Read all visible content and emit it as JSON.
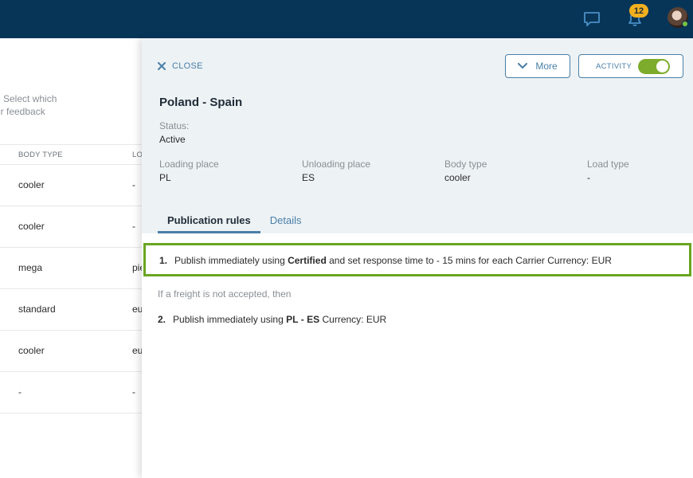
{
  "topbar": {
    "notification_count": "12",
    "colors": {
      "background": "#073558",
      "badge": "#f2b01e"
    },
    "icons": [
      "chat-icon",
      "bell-icon",
      "user-avatar"
    ]
  },
  "background_page": {
    "description_line_1": "Select which",
    "description_line_2": "ir feedback",
    "columns": [
      "BODY TYPE",
      "LO"
    ],
    "rows": [
      [
        "cooler",
        "-"
      ],
      [
        "cooler",
        "-"
      ],
      [
        "mega",
        "pie"
      ],
      [
        "standard",
        "eu"
      ],
      [
        "cooler",
        "eu"
      ],
      [
        "-",
        "-"
      ]
    ]
  },
  "panel": {
    "close_label": "CLOSE",
    "more_label": "More",
    "activity_label": "ACTIVITY",
    "activity_enabled": true,
    "title": "Poland - Spain",
    "status": {
      "label": "Status:",
      "value": "Active"
    },
    "fields": [
      {
        "label": "Loading place",
        "value": "PL"
      },
      {
        "label": "Unloading place",
        "value": "ES"
      },
      {
        "label": "Body type",
        "value": "cooler"
      },
      {
        "label": "Load type",
        "value": "-"
      }
    ],
    "tabs": [
      {
        "label": "Publication rules",
        "active": true
      },
      {
        "label": "Details",
        "active": false
      }
    ],
    "rule_1": {
      "number": "1.",
      "prefix": "Publish immediately using",
      "group": "Certified",
      "suffix": "and set response time to - 15 mins for each Carrier Currency: EUR"
    },
    "fallback_text": "If a freight is not accepted, then",
    "rule_2": {
      "number": "2.",
      "prefix": "Publish immediately using",
      "from": "PL",
      "separator": "-",
      "to": "ES",
      "suffix": "Currency: EUR"
    },
    "colors": {
      "accent": "#4a7fa8",
      "toggle": "#7dac2c",
      "highlight": "#6aa521",
      "header_bg": "#edf2f5"
    }
  }
}
